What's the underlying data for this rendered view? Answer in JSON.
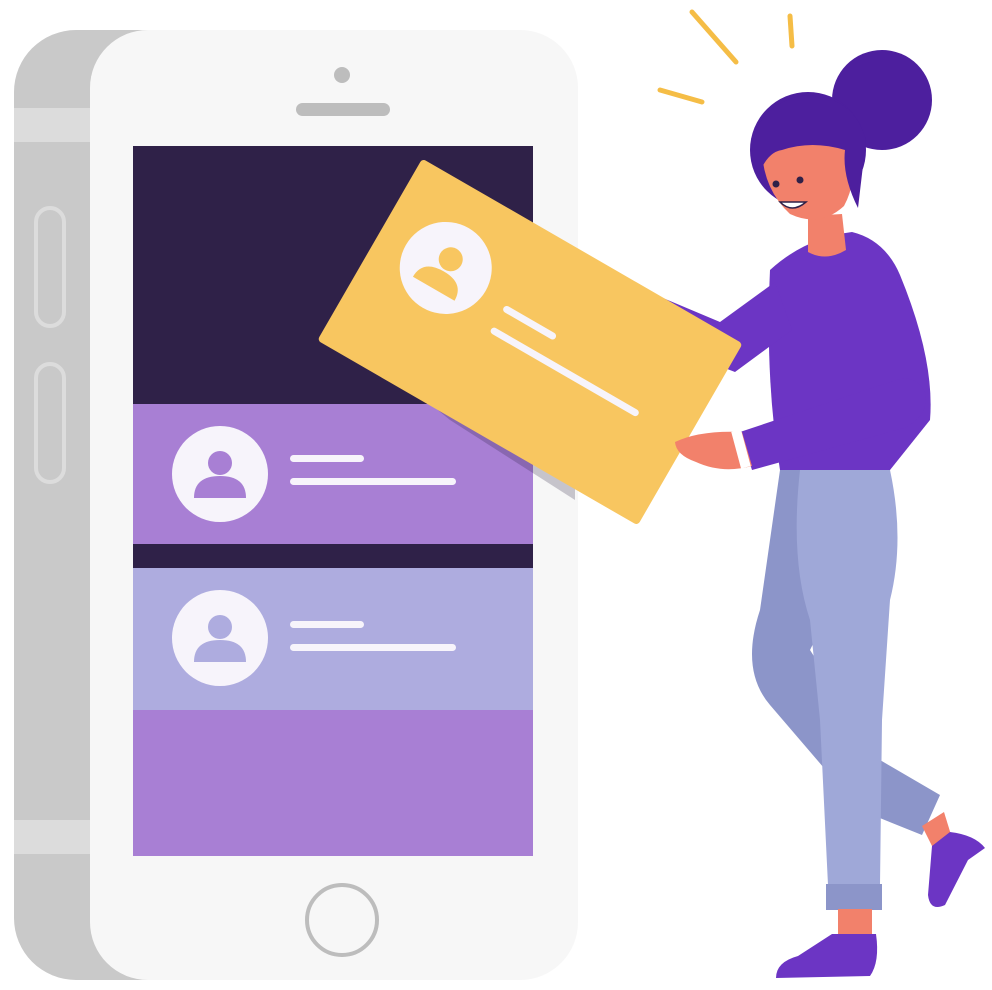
{
  "illustration": {
    "colors": {
      "background": "#ffffff",
      "phone_back": "#c9c9c9",
      "phone_back_stripe": "#dcdcdc",
      "phone_front": "#f7f7f7",
      "phone_detail": "#bdbdbd",
      "screen_top": "#2f2148",
      "screen_divider": "#2f2148",
      "card_1": "#a87fd4",
      "card_2": "#aeacdf",
      "screen_bottom": "#a87fd4",
      "held_card": "#f8c660",
      "avatar_circle": "#f7f4fb",
      "avatar_figure_1": "#a87fd4",
      "avatar_figure_2": "#aeacdf",
      "avatar_figure_held": "#f8c660",
      "text_line": "#f7f4fb",
      "skin": "#f2816b",
      "hair": "#4d1f9e",
      "shirt": "#6c35c4",
      "pants": "#9fa8d8",
      "pants_shade": "#8c95c9",
      "shoes": "#6c35c4",
      "sparkle": "#f5bd46"
    },
    "icons": [
      "phone-camera-icon",
      "phone-speaker-icon",
      "home-button-icon",
      "user-avatar-icon"
    ]
  }
}
